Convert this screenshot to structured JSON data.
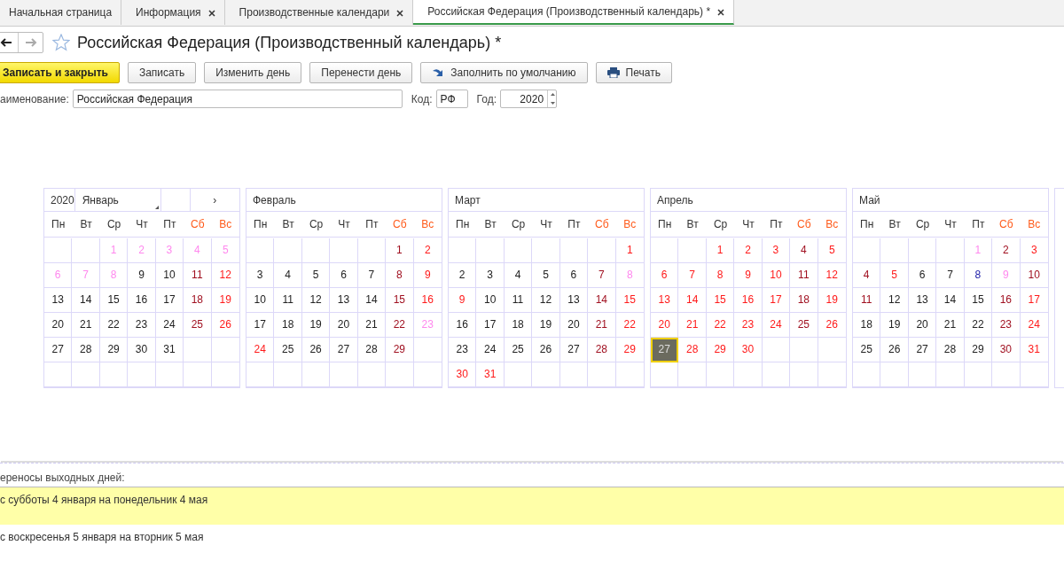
{
  "tabs": [
    {
      "label": "Начальная страница",
      "closable": false,
      "selected": false
    },
    {
      "label": "Информация",
      "closable": true,
      "selected": false
    },
    {
      "label": "Производственные календари",
      "closable": true,
      "selected": false
    },
    {
      "label": "Российская Федерация (Производственный календарь) *",
      "closable": true,
      "selected": true
    }
  ],
  "title": "Российская Федерация (Производственный календарь) *",
  "buttons": [
    {
      "label": "Записать и закрыть",
      "kind": "primary"
    },
    {
      "label": "Записать",
      "kind": "plain"
    },
    {
      "label": "Изменить день",
      "kind": "plain"
    },
    {
      "label": "Перенести день",
      "kind": "plain"
    },
    {
      "label": "Заполнить по умолчанию",
      "kind": "fill"
    },
    {
      "label": "Печать",
      "kind": "print"
    }
  ],
  "fields": {
    "name_label": "аименование:",
    "name_value": "Российская Федерация",
    "code_label": "Код:",
    "code_value": "РФ",
    "year_label": "Год:",
    "year_value": "2020"
  },
  "calendar": {
    "year": "2020",
    "next": "›",
    "months": [
      {
        "name": "Январь",
        "weekdays": [
          {
            "t": "Пн",
            "weekend": false
          },
          {
            "t": "Вт",
            "weekend": false
          },
          {
            "t": "Ср",
            "weekend": false
          },
          {
            "t": "Чт",
            "weekend": false
          },
          {
            "t": "Пт",
            "weekend": false
          },
          {
            "t": "Сб",
            "weekend": true
          },
          {
            "t": "Вс",
            "weekend": true
          }
        ],
        "weeks": [
          [
            {
              "d": "1",
              "kind": "holiday",
              "selected": false
            },
            {
              "d": "2",
              "kind": "holiday",
              "selected": false
            },
            {
              "d": "3",
              "kind": "holiday",
              "selected": false
            },
            {
              "d": "4",
              "kind": "holiday",
              "selected": false
            },
            {
              "d": "5",
              "kind": "holiday",
              "selected": false
            }
          ],
          [
            {
              "d": "6",
              "kind": "holiday",
              "selected": false
            },
            {
              "d": "7",
              "kind": "holiday",
              "selected": false
            },
            {
              "d": "8",
              "kind": "holiday",
              "selected": false
            },
            {
              "d": "9",
              "kind": "work",
              "selected": false
            },
            {
              "d": "10",
              "kind": "work",
              "selected": false
            },
            {
              "d": "11",
              "kind": "saturday",
              "selected": false
            },
            {
              "d": "12",
              "kind": "dayoff",
              "selected": false
            }
          ],
          [
            {
              "d": "13",
              "kind": "work",
              "selected": false
            },
            {
              "d": "14",
              "kind": "work",
              "selected": false
            },
            {
              "d": "15",
              "kind": "work",
              "selected": false
            },
            {
              "d": "16",
              "kind": "work",
              "selected": false
            },
            {
              "d": "17",
              "kind": "work",
              "selected": false
            },
            {
              "d": "18",
              "kind": "saturday",
              "selected": false
            },
            {
              "d": "19",
              "kind": "dayoff",
              "selected": false
            }
          ],
          [
            {
              "d": "20",
              "kind": "work",
              "selected": false
            },
            {
              "d": "21",
              "kind": "work",
              "selected": false
            },
            {
              "d": "22",
              "kind": "work",
              "selected": false
            },
            {
              "d": "23",
              "kind": "work",
              "selected": false
            },
            {
              "d": "24",
              "kind": "work",
              "selected": false
            },
            {
              "d": "25",
              "kind": "saturday",
              "selected": false
            },
            {
              "d": "26",
              "kind": "dayoff",
              "selected": false
            }
          ],
          [
            {
              "d": "27",
              "kind": "work",
              "selected": false
            },
            {
              "d": "28",
              "kind": "work",
              "selected": false
            },
            {
              "d": "29",
              "kind": "work",
              "selected": false
            },
            {
              "d": "30",
              "kind": "work",
              "selected": false
            },
            {
              "d": "31",
              "kind": "work",
              "selected": false
            }
          ]
        ]
      },
      {
        "name": "Февраль",
        "weekdays": [
          {
            "t": "Пн",
            "weekend": false
          },
          {
            "t": "Вт",
            "weekend": false
          },
          {
            "t": "Ср",
            "weekend": false
          },
          {
            "t": "Чт",
            "weekend": false
          },
          {
            "t": "Пт",
            "weekend": false
          },
          {
            "t": "Сб",
            "weekend": true
          },
          {
            "t": "Вс",
            "weekend": true
          }
        ],
        "weeks": [
          [
            {
              "d": "1",
              "kind": "saturday",
              "selected": false
            },
            {
              "d": "2",
              "kind": "dayoff",
              "selected": false
            }
          ],
          [
            {
              "d": "3",
              "kind": "work",
              "selected": false
            },
            {
              "d": "4",
              "kind": "work",
              "selected": false
            },
            {
              "d": "5",
              "kind": "work",
              "selected": false
            },
            {
              "d": "6",
              "kind": "work",
              "selected": false
            },
            {
              "d": "7",
              "kind": "work",
              "selected": false
            },
            {
              "d": "8",
              "kind": "saturday",
              "selected": false
            },
            {
              "d": "9",
              "kind": "dayoff",
              "selected": false
            }
          ],
          [
            {
              "d": "10",
              "kind": "work",
              "selected": false
            },
            {
              "d": "11",
              "kind": "work",
              "selected": false
            },
            {
              "d": "12",
              "kind": "work",
              "selected": false
            },
            {
              "d": "13",
              "kind": "work",
              "selected": false
            },
            {
              "d": "14",
              "kind": "work",
              "selected": false
            },
            {
              "d": "15",
              "kind": "saturday",
              "selected": false
            },
            {
              "d": "16",
              "kind": "dayoff",
              "selected": false
            }
          ],
          [
            {
              "d": "17",
              "kind": "work",
              "selected": false
            },
            {
              "d": "18",
              "kind": "work",
              "selected": false
            },
            {
              "d": "19",
              "kind": "work",
              "selected": false
            },
            {
              "d": "20",
              "kind": "work",
              "selected": false
            },
            {
              "d": "21",
              "kind": "work",
              "selected": false
            },
            {
              "d": "22",
              "kind": "saturday",
              "selected": false
            },
            {
              "d": "23",
              "kind": "holiday",
              "selected": false
            }
          ],
          [
            {
              "d": "24",
              "kind": "dayoff",
              "selected": false
            },
            {
              "d": "25",
              "kind": "work",
              "selected": false
            },
            {
              "d": "26",
              "kind": "work",
              "selected": false
            },
            {
              "d": "27",
              "kind": "work",
              "selected": false
            },
            {
              "d": "28",
              "kind": "work",
              "selected": false
            },
            {
              "d": "29",
              "kind": "saturday",
              "selected": false
            }
          ]
        ]
      },
      {
        "name": "Март",
        "weekdays": [
          {
            "t": "Пн",
            "weekend": false
          },
          {
            "t": "Вт",
            "weekend": false
          },
          {
            "t": "Ср",
            "weekend": false
          },
          {
            "t": "Чт",
            "weekend": false
          },
          {
            "t": "Пт",
            "weekend": false
          },
          {
            "t": "Сб",
            "weekend": true
          },
          {
            "t": "Вс",
            "weekend": true
          }
        ],
        "weeks": [
          [
            {
              "d": "1",
              "kind": "dayoff",
              "selected": false
            }
          ],
          [
            {
              "d": "2",
              "kind": "work",
              "selected": false
            },
            {
              "d": "3",
              "kind": "work",
              "selected": false
            },
            {
              "d": "4",
              "kind": "work",
              "selected": false
            },
            {
              "d": "5",
              "kind": "work",
              "selected": false
            },
            {
              "d": "6",
              "kind": "work",
              "selected": false
            },
            {
              "d": "7",
              "kind": "saturday",
              "selected": false
            },
            {
              "d": "8",
              "kind": "holiday",
              "selected": false
            }
          ],
          [
            {
              "d": "9",
              "kind": "dayoff",
              "selected": false
            },
            {
              "d": "10",
              "kind": "work",
              "selected": false
            },
            {
              "d": "11",
              "kind": "work",
              "selected": false
            },
            {
              "d": "12",
              "kind": "work",
              "selected": false
            },
            {
              "d": "13",
              "kind": "work",
              "selected": false
            },
            {
              "d": "14",
              "kind": "saturday",
              "selected": false
            },
            {
              "d": "15",
              "kind": "dayoff",
              "selected": false
            }
          ],
          [
            {
              "d": "16",
              "kind": "work",
              "selected": false
            },
            {
              "d": "17",
              "kind": "work",
              "selected": false
            },
            {
              "d": "18",
              "kind": "work",
              "selected": false
            },
            {
              "d": "19",
              "kind": "work",
              "selected": false
            },
            {
              "d": "20",
              "kind": "work",
              "selected": false
            },
            {
              "d": "21",
              "kind": "saturday",
              "selected": false
            },
            {
              "d": "22",
              "kind": "dayoff",
              "selected": false
            }
          ],
          [
            {
              "d": "23",
              "kind": "work",
              "selected": false
            },
            {
              "d": "24",
              "kind": "work",
              "selected": false
            },
            {
              "d": "25",
              "kind": "work",
              "selected": false
            },
            {
              "d": "26",
              "kind": "work",
              "selected": false
            },
            {
              "d": "27",
              "kind": "work",
              "selected": false
            },
            {
              "d": "28",
              "kind": "saturday",
              "selected": false
            },
            {
              "d": "29",
              "kind": "dayoff",
              "selected": false
            }
          ],
          [
            {
              "d": "30",
              "kind": "dayoff",
              "selected": false
            },
            {
              "d": "31",
              "kind": "dayoff",
              "selected": false
            }
          ]
        ]
      },
      {
        "name": "Апрель",
        "weekdays": [
          {
            "t": "Пн",
            "weekend": false
          },
          {
            "t": "Вт",
            "weekend": false
          },
          {
            "t": "Ср",
            "weekend": false
          },
          {
            "t": "Чт",
            "weekend": false
          },
          {
            "t": "Пт",
            "weekend": false
          },
          {
            "t": "Сб",
            "weekend": true
          },
          {
            "t": "Вс",
            "weekend": true
          }
        ],
        "weeks": [
          [
            {
              "d": "1",
              "kind": "dayoff",
              "selected": false
            },
            {
              "d": "2",
              "kind": "dayoff",
              "selected": false
            },
            {
              "d": "3",
              "kind": "dayoff",
              "selected": false
            },
            {
              "d": "4",
              "kind": "saturday",
              "selected": false
            },
            {
              "d": "5",
              "kind": "dayoff",
              "selected": false
            }
          ],
          [
            {
              "d": "6",
              "kind": "dayoff",
              "selected": false
            },
            {
              "d": "7",
              "kind": "dayoff",
              "selected": false
            },
            {
              "d": "8",
              "kind": "dayoff",
              "selected": false
            },
            {
              "d": "9",
              "kind": "dayoff",
              "selected": false
            },
            {
              "d": "10",
              "kind": "dayoff",
              "selected": false
            },
            {
              "d": "11",
              "kind": "saturday",
              "selected": false
            },
            {
              "d": "12",
              "kind": "dayoff",
              "selected": false
            }
          ],
          [
            {
              "d": "13",
              "kind": "dayoff",
              "selected": false
            },
            {
              "d": "14",
              "kind": "dayoff",
              "selected": false
            },
            {
              "d": "15",
              "kind": "dayoff",
              "selected": false
            },
            {
              "d": "16",
              "kind": "dayoff",
              "selected": false
            },
            {
              "d": "17",
              "kind": "dayoff",
              "selected": false
            },
            {
              "d": "18",
              "kind": "saturday",
              "selected": false
            },
            {
              "d": "19",
              "kind": "dayoff",
              "selected": false
            }
          ],
          [
            {
              "d": "20",
              "kind": "dayoff",
              "selected": false
            },
            {
              "d": "21",
              "kind": "dayoff",
              "selected": false
            },
            {
              "d": "22",
              "kind": "dayoff",
              "selected": false
            },
            {
              "d": "23",
              "kind": "dayoff",
              "selected": false
            },
            {
              "d": "24",
              "kind": "dayoff",
              "selected": false
            },
            {
              "d": "25",
              "kind": "saturday",
              "selected": false
            },
            {
              "d": "26",
              "kind": "dayoff",
              "selected": false
            }
          ],
          [
            {
              "d": "27",
              "kind": "dayoff",
              "selected": true
            },
            {
              "d": "28",
              "kind": "dayoff",
              "selected": false
            },
            {
              "d": "29",
              "kind": "dayoff",
              "selected": false
            },
            {
              "d": "30",
              "kind": "dayoff",
              "selected": false
            }
          ]
        ]
      },
      {
        "name": "Май",
        "weekdays": [
          {
            "t": "Пн",
            "weekend": false
          },
          {
            "t": "Вт",
            "weekend": false
          },
          {
            "t": "Ср",
            "weekend": false
          },
          {
            "t": "Чт",
            "weekend": false
          },
          {
            "t": "Пт",
            "weekend": false
          },
          {
            "t": "Сб",
            "weekend": true
          },
          {
            "t": "Вс",
            "weekend": true
          }
        ],
        "weeks": [
          [
            {
              "d": "1",
              "kind": "holiday",
              "selected": false
            },
            {
              "d": "2",
              "kind": "saturday",
              "selected": false
            },
            {
              "d": "3",
              "kind": "dayoff",
              "selected": false
            }
          ],
          [
            {
              "d": "4",
              "kind": "saturday",
              "selected": false
            },
            {
              "d": "5",
              "kind": "dayoff",
              "selected": false
            },
            {
              "d": "6",
              "kind": "work",
              "selected": false
            },
            {
              "d": "7",
              "kind": "work",
              "selected": false
            },
            {
              "d": "8",
              "kind": "preholiday",
              "selected": false
            },
            {
              "d": "9",
              "kind": "holiday",
              "selected": false
            },
            {
              "d": "10",
              "kind": "saturday",
              "selected": false
            }
          ],
          [
            {
              "d": "11",
              "kind": "saturday",
              "selected": false
            },
            {
              "d": "12",
              "kind": "work",
              "selected": false
            },
            {
              "d": "13",
              "kind": "work",
              "selected": false
            },
            {
              "d": "14",
              "kind": "work",
              "selected": false
            },
            {
              "d": "15",
              "kind": "work",
              "selected": false
            },
            {
              "d": "16",
              "kind": "saturday",
              "selected": false
            },
            {
              "d": "17",
              "kind": "dayoff",
              "selected": false
            }
          ],
          [
            {
              "d": "18",
              "kind": "work",
              "selected": false
            },
            {
              "d": "19",
              "kind": "work",
              "selected": false
            },
            {
              "d": "20",
              "kind": "work",
              "selected": false
            },
            {
              "d": "21",
              "kind": "work",
              "selected": false
            },
            {
              "d": "22",
              "kind": "work",
              "selected": false
            },
            {
              "d": "23",
              "kind": "saturday",
              "selected": false
            },
            {
              "d": "24",
              "kind": "dayoff",
              "selected": false
            }
          ],
          [
            {
              "d": "25",
              "kind": "work",
              "selected": false
            },
            {
              "d": "26",
              "kind": "work",
              "selected": false
            },
            {
              "d": "27",
              "kind": "work",
              "selected": false
            },
            {
              "d": "28",
              "kind": "work",
              "selected": false
            },
            {
              "d": "29",
              "kind": "work",
              "selected": false
            },
            {
              "d": "30",
              "kind": "saturday",
              "selected": false
            },
            {
              "d": "31",
              "kind": "dayoff",
              "selected": false
            }
          ]
        ]
      }
    ]
  },
  "transfers": {
    "label": "ереносы выходных дней:",
    "rows": [
      {
        "text": "с субботы 4 января на понедельник 4 мая",
        "selected": true
      },
      {
        "text": "с воскресенья 5 января на вторник 5 мая",
        "selected": false
      }
    ]
  }
}
